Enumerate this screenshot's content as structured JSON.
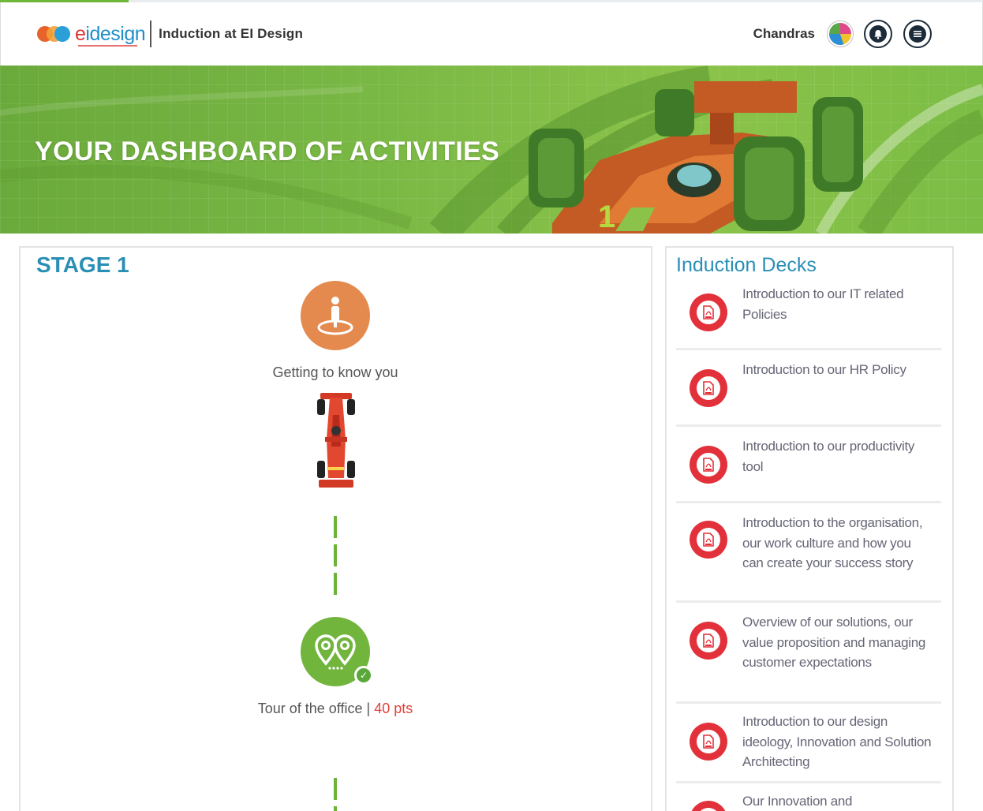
{
  "header": {
    "logo_text_first": "e",
    "logo_text_rest": "idesign",
    "app_title": "Induction at EI Design",
    "user_name": "Chandras",
    "icons": [
      "avatar",
      "bell-icon",
      "menu-icon"
    ]
  },
  "banner": {
    "title": "YOUR DASHBOARD OF ACTIVITIES"
  },
  "stage": {
    "title": "STAGE 1",
    "activities": [
      {
        "label": "Getting to  know you",
        "points": "",
        "icon": "person-location-icon",
        "completed": false
      },
      {
        "label": "Tour of the office | ",
        "points": "40 pts",
        "icon": "map-pins-icon",
        "completed": true
      }
    ]
  },
  "decks": {
    "title": "Induction Decks",
    "items": [
      {
        "label": "Introduction to our IT related Policies",
        "icon": "pdf-icon"
      },
      {
        "label": "Introduction to our HR Policy",
        "icon": "pdf-icon"
      },
      {
        "label": "Introduction to our productivity tool",
        "icon": "pdf-icon"
      },
      {
        "label": "Introduction to the organisation, our work culture and how you can create your success story",
        "icon": "pdf-icon"
      },
      {
        "label": "Overview of our solutions, our value proposition and managing customer expectations",
        "icon": "pdf-icon"
      },
      {
        "label": "Introduction to our design ideology, Innovation and Solution Architecting",
        "icon": "pdf-icon"
      },
      {
        "label": "Our Innovation and",
        "icon": "pdf-icon"
      }
    ]
  },
  "colors": {
    "accent_teal": "#2a8fb5",
    "banner_green": "#78b744",
    "pdf_red": "#e2313a",
    "points_red": "#e2413a",
    "orange_activity": "#e58a4e",
    "green_activity": "#72b53d"
  }
}
